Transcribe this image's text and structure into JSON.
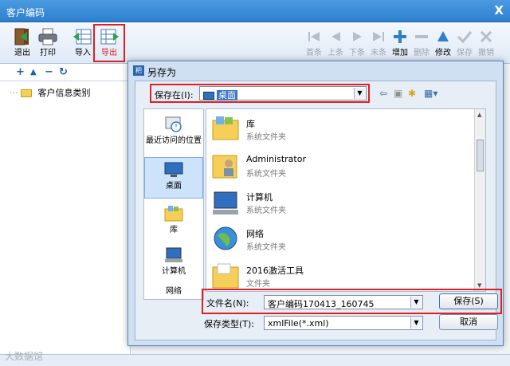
{
  "main_window": {
    "title": "客户编码",
    "close_glyph": "X"
  },
  "toolbar": {
    "exit": "退出",
    "print": "打印",
    "import": "导入",
    "export": "导出",
    "first": "首条",
    "prev": "上条",
    "next": "下条",
    "last": "末条",
    "add": "增加",
    "delete": "删除",
    "edit": "修改",
    "save": "保存",
    "cancel": "撤销"
  },
  "tree": {
    "root_label": "客户信息类别"
  },
  "dialog": {
    "title": "另存为",
    "icon_text": "粑",
    "save_in_label": "保存在(I):",
    "save_in_value": "桌面",
    "places": [
      {
        "label": "最近访问的位置"
      },
      {
        "label": "桌面"
      },
      {
        "label": "库"
      },
      {
        "label": "计算机"
      },
      {
        "label": "网络"
      }
    ],
    "files": [
      {
        "name": "库",
        "type": "系统文件夹"
      },
      {
        "name": "Administrator",
        "type": "系统文件夹"
      },
      {
        "name": "计算机",
        "type": "系统文件夹"
      },
      {
        "name": "网络",
        "type": "系统文件夹"
      },
      {
        "name": "2016激活工具",
        "type": "文件夹"
      }
    ],
    "filename_label": "文件名(N):",
    "filename_value": "客户编码170413_160745",
    "filetype_label": "保存类型(T):",
    "filetype_value": "xmlFile(*.xml)",
    "save_button": "保存(S)",
    "cancel_button": "取消"
  },
  "watermark": "大数据馆",
  "colors": {
    "accent": "#2f7fcf",
    "highlight_border": "#e02020"
  }
}
